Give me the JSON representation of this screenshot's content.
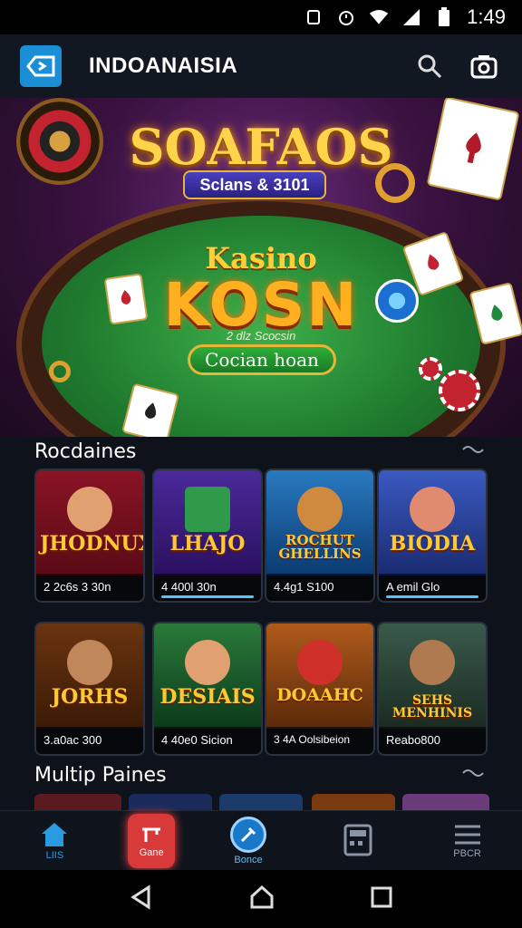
{
  "status_bar": {
    "time": "1:49"
  },
  "app_bar": {
    "title": "INDOANAISIA"
  },
  "hero": {
    "title": "SOAFAOS",
    "subtitle": "Sclans & 3101",
    "kasino": "Kasino",
    "brand": "KOSN",
    "caption": "2 dlz Scocsin",
    "cta": "Cocian hoan"
  },
  "sections": [
    {
      "title": "Rocdaines",
      "tiles": [
        {
          "name": "JHODNUX",
          "info": "2 2c6s 3 30n",
          "bg": "#7a1020"
        },
        {
          "name": "LHAJO",
          "info": "4 400l 30n",
          "bg": "#3a1a7a"
        },
        {
          "name": "ROCHUT GHELLINS",
          "info": "4.4g1 S100",
          "bg": "#1a5a9a"
        },
        {
          "name": "BIODIA",
          "info": "A emil Glo",
          "bg": "#2a4a9a"
        }
      ]
    },
    {
      "title": "",
      "tiles": [
        {
          "name": "JORHS",
          "info": "3.a0ac 300",
          "bg": "#5a2a0a"
        },
        {
          "name": "DESIAIS",
          "info": "4 40e0 Sicion",
          "bg": "#1a5a2a"
        },
        {
          "name": "DOAAHC",
          "info": "3 4A Oolsibeion",
          "bg": "#8a3a0a"
        },
        {
          "name": "SEHS MENHINIS",
          "info": "Reabo800",
          "bg": "#2a4a3a"
        }
      ]
    },
    {
      "title": "Multip Paines"
    }
  ],
  "tab_bar": [
    {
      "label": "LIIS",
      "icon": "home-icon",
      "active": true
    },
    {
      "label": "Gane",
      "icon": "game-icon",
      "active": false
    },
    {
      "label": "Bonce",
      "icon": "tools-icon",
      "active": false
    },
    {
      "label": "",
      "icon": "calculator-icon",
      "active": false
    },
    {
      "label": "PBCR",
      "icon": "menu-icon",
      "active": false
    }
  ]
}
